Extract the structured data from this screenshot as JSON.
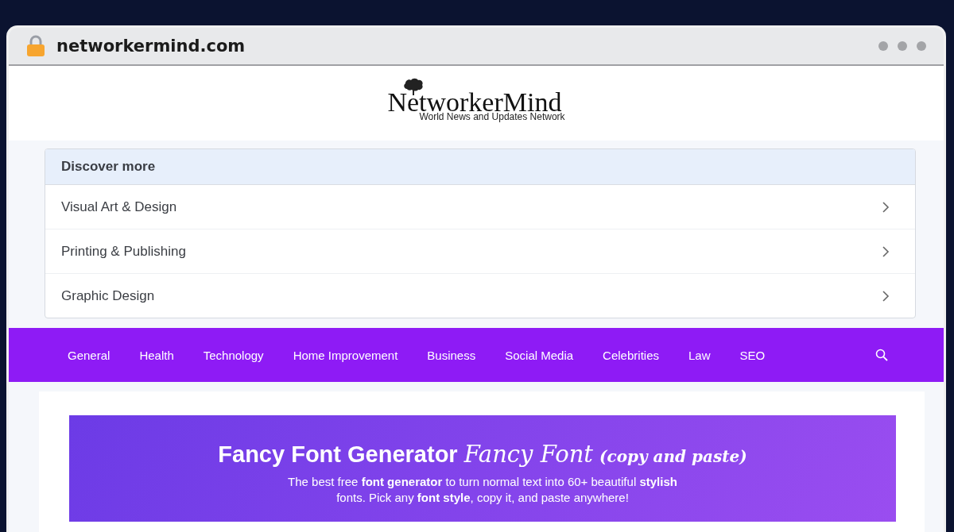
{
  "browser": {
    "url": "networkermind.com"
  },
  "header": {
    "logo_title": "NetworkerMind",
    "logo_tagline": "World News and Updates Network"
  },
  "discover": {
    "title": "Discover more",
    "items": [
      "Visual Art & Design",
      "Printing & Publishing",
      "Graphic Design"
    ]
  },
  "nav": {
    "items": [
      "General",
      "Health",
      "Technology",
      "Home Improvement",
      "Business",
      "Social Media",
      "Celebrities",
      "Law",
      "SEO"
    ]
  },
  "hero": {
    "title": "Fancy Font Generator",
    "title_fancy": "Fancy Font",
    "title_note": "(copy and paste)",
    "lines": [
      "The best free **font generator** to turn normal text into 60+ beautiful **stylish**",
      "fonts. Pick any **font style**, copy it, and paste anywhere!"
    ]
  }
}
